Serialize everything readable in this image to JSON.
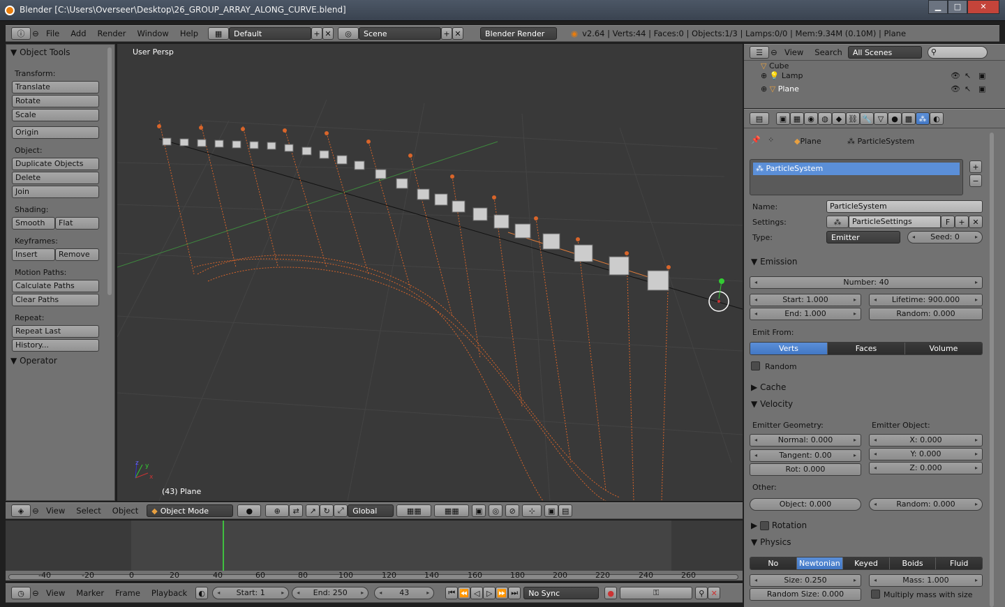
{
  "window": {
    "title": "Blender [C:\\Users\\Overseer\\Desktop\\26_GROUP_ARRAY_ALONG_CURVE.blend]",
    "minimize": "▁",
    "maximize": "□",
    "close": "✕"
  },
  "info_header": {
    "menus": [
      "File",
      "Add",
      "Render",
      "Window",
      "Help"
    ],
    "layout": "Default",
    "scene": "Scene",
    "engine": "Blender Render",
    "stats": "v2.64 | Verts:44 | Faces:0 | Objects:1/3 | Lamps:0/0 | Mem:9.34M (0.10M) | Plane"
  },
  "tools": {
    "title": "Object Tools",
    "transform_label": "Transform:",
    "translate": "Translate",
    "rotate": "Rotate",
    "scale": "Scale",
    "origin": "Origin",
    "object_label": "Object:",
    "duplicate": "Duplicate Objects",
    "delete": "Delete",
    "join": "Join",
    "shading_label": "Shading:",
    "smooth": "Smooth",
    "flat": "Flat",
    "keyframes_label": "Keyframes:",
    "insert": "Insert",
    "remove": "Remove",
    "motion_label": "Motion Paths:",
    "calc_paths": "Calculate Paths",
    "clear_paths": "Clear Paths",
    "repeat_label": "Repeat:",
    "repeat_last": "Repeat Last",
    "history": "History...",
    "operator": "Operator"
  },
  "viewport": {
    "label": "User Persp",
    "object_label": "(43) Plane",
    "axes": {
      "x": "x",
      "y": "y",
      "z": "z"
    }
  },
  "view3d_header": {
    "menus": [
      "View",
      "Select",
      "Object"
    ],
    "mode": "Object Mode",
    "orientation": "Global"
  },
  "outliner": {
    "menus": [
      "View",
      "Search"
    ],
    "scenes": "All Scenes",
    "items": [
      "Cube",
      "Lamp",
      "Plane"
    ]
  },
  "properties": {
    "breadcrumb_object": "Plane",
    "breadcrumb_psys": "ParticleSystem",
    "list_item": "ParticleSystem",
    "name_label": "Name:",
    "name_value": "ParticleSystem",
    "settings_label": "Settings:",
    "settings_value": "ParticleSettings",
    "settings_fake": "F",
    "type_label": "Type:",
    "type_value": "Emitter",
    "seed": "Seed: 0",
    "emission": {
      "title": "Emission",
      "number": "Number: 40",
      "start": "Start: 1.000",
      "lifetime": "Lifetime: 900.000",
      "end": "End: 1.000",
      "random": "Random: 0.000",
      "emit_from_label": "Emit From:",
      "emit_from": [
        "Verts",
        "Faces",
        "Volume"
      ],
      "random_chk": "Random"
    },
    "cache": {
      "title": "Cache"
    },
    "velocity": {
      "title": "Velocity",
      "geom_label": "Emitter Geometry:",
      "obj_label": "Emitter Object:",
      "normal": "Normal: 0.000",
      "x": "X: 0.000",
      "tangent": "Tangent: 0.00",
      "y": "Y: 0.000",
      "rot": "Rot: 0.000",
      "z": "Z: 0.000",
      "other_label": "Other:",
      "object": "Object: 0.000",
      "random": "Random: 0.000"
    },
    "rotation": {
      "title": "Rotation"
    },
    "physics": {
      "title": "Physics",
      "types": [
        "No",
        "Newtonian",
        "Keyed",
        "Boids",
        "Fluid"
      ],
      "size": "Size: 0.250",
      "mass": "Mass: 1.000",
      "random_size": "Random Size: 0.000",
      "multiply": "Multiply mass with size"
    }
  },
  "timeline": {
    "ticks": [
      "-40",
      "-20",
      "0",
      "20",
      "40",
      "60",
      "80",
      "100",
      "120",
      "140",
      "160",
      "180",
      "200",
      "220",
      "240",
      "260"
    ],
    "menus": [
      "View",
      "Marker",
      "Frame",
      "Playback"
    ],
    "start": "Start: 1",
    "end": "End: 250",
    "current": "43",
    "sync": "No Sync"
  },
  "colors": {
    "accent": "#5b8fd8",
    "particle": "#d9652a",
    "grid_x": "#7a2a2a",
    "grid_y": "#2a7a2a"
  }
}
